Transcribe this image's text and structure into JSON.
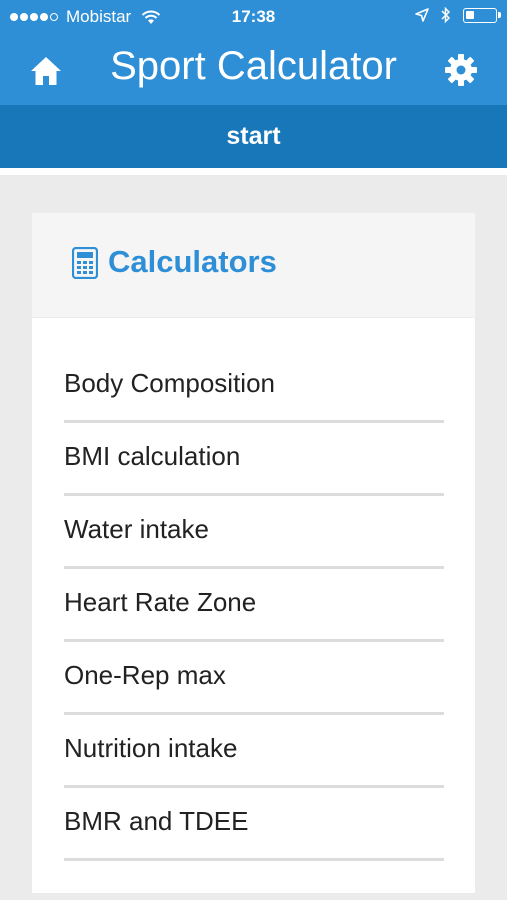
{
  "status_bar": {
    "carrier": "Mobistar",
    "time": "17:38",
    "signal_bars": 4,
    "signal_max": 5,
    "battery_level": 0.3
  },
  "header": {
    "title": "Sport Calculator",
    "home_icon": "home-icon",
    "settings_icon": "gear-icon",
    "subtitle": "start",
    "primary_color": "#2e8fd6",
    "secondary_color": "#1777b9"
  },
  "card": {
    "title": "Calculators",
    "icon": "calculator-icon",
    "items": [
      {
        "label": "Body Composition"
      },
      {
        "label": "BMI calculation"
      },
      {
        "label": "Water intake"
      },
      {
        "label": "Heart Rate Zone"
      },
      {
        "label": "One-Rep max"
      },
      {
        "label": "Nutrition intake"
      },
      {
        "label": "BMR and TDEE"
      }
    ]
  }
}
